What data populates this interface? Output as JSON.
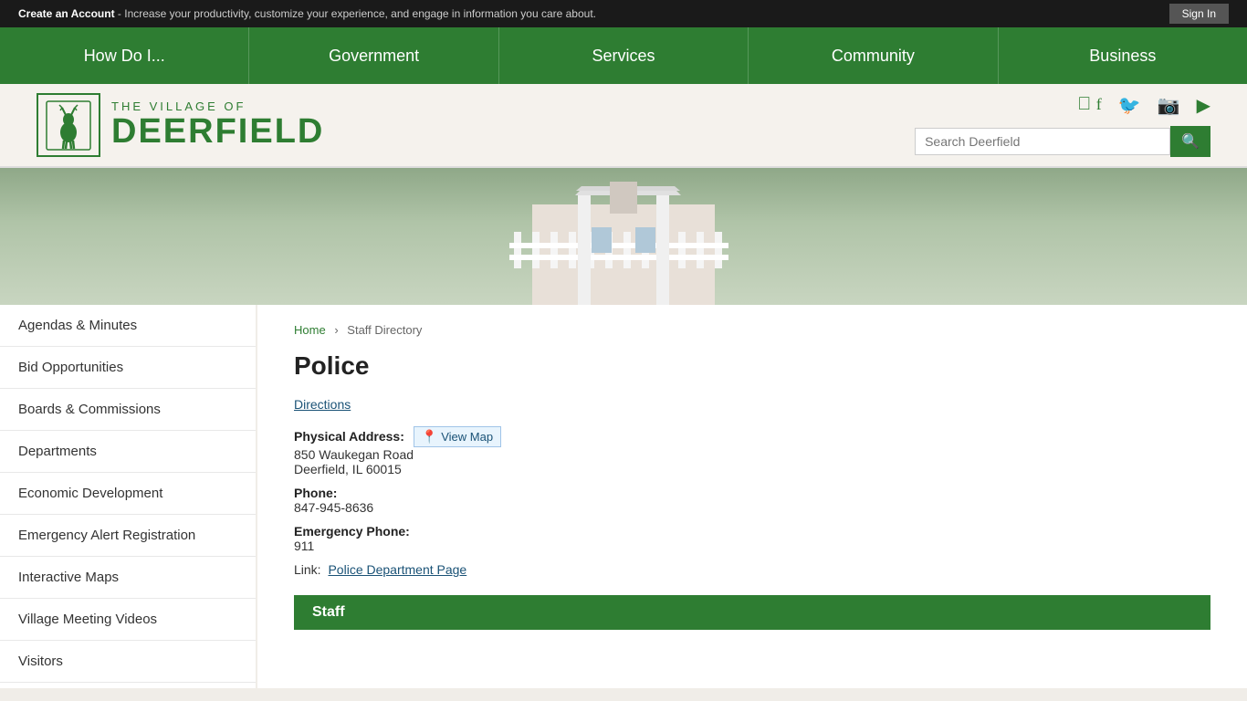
{
  "topbar": {
    "message_prefix": "Create an Account",
    "message_suffix": " - Increase your productivity, customize your experience, and engage in information you care about.",
    "sign_in_label": "Sign In"
  },
  "nav": {
    "items": [
      {
        "label": "How Do I...",
        "id": "how-do-i"
      },
      {
        "label": "Government",
        "id": "government"
      },
      {
        "label": "Services",
        "id": "services"
      },
      {
        "label": "Community",
        "id": "community"
      },
      {
        "label": "Business",
        "id": "business"
      }
    ]
  },
  "header": {
    "logo_village_of": "THE VILLAGE OF",
    "logo_deerfield": "DEERFIELD",
    "search_placeholder": "Search Deerfield"
  },
  "sidebar": {
    "items": [
      {
        "label": "Agendas & Minutes"
      },
      {
        "label": "Bid Opportunities"
      },
      {
        "label": "Boards & Commissions"
      },
      {
        "label": "Departments"
      },
      {
        "label": "Economic Development"
      },
      {
        "label": "Emergency Alert Registration"
      },
      {
        "label": "Interactive Maps"
      },
      {
        "label": "Village Meeting Videos"
      },
      {
        "label": "Visitors"
      }
    ]
  },
  "breadcrumb": {
    "home_label": "Home",
    "separator": "›",
    "current": "Staff Directory"
  },
  "page": {
    "title": "Police",
    "directions_label": "Directions",
    "physical_address_label": "Physical Address:",
    "view_map_label": "View Map",
    "address_line1": "850 Waukegan Road",
    "address_line2": "Deerfield, IL 60015",
    "phone_label": "Phone:",
    "phone_value": "847-945-8636",
    "emergency_phone_label": "Emergency Phone:",
    "emergency_phone_value": "911",
    "link_label": "Link:",
    "dept_link_label": "Police Department Page",
    "staff_bar_label": "Staff"
  }
}
